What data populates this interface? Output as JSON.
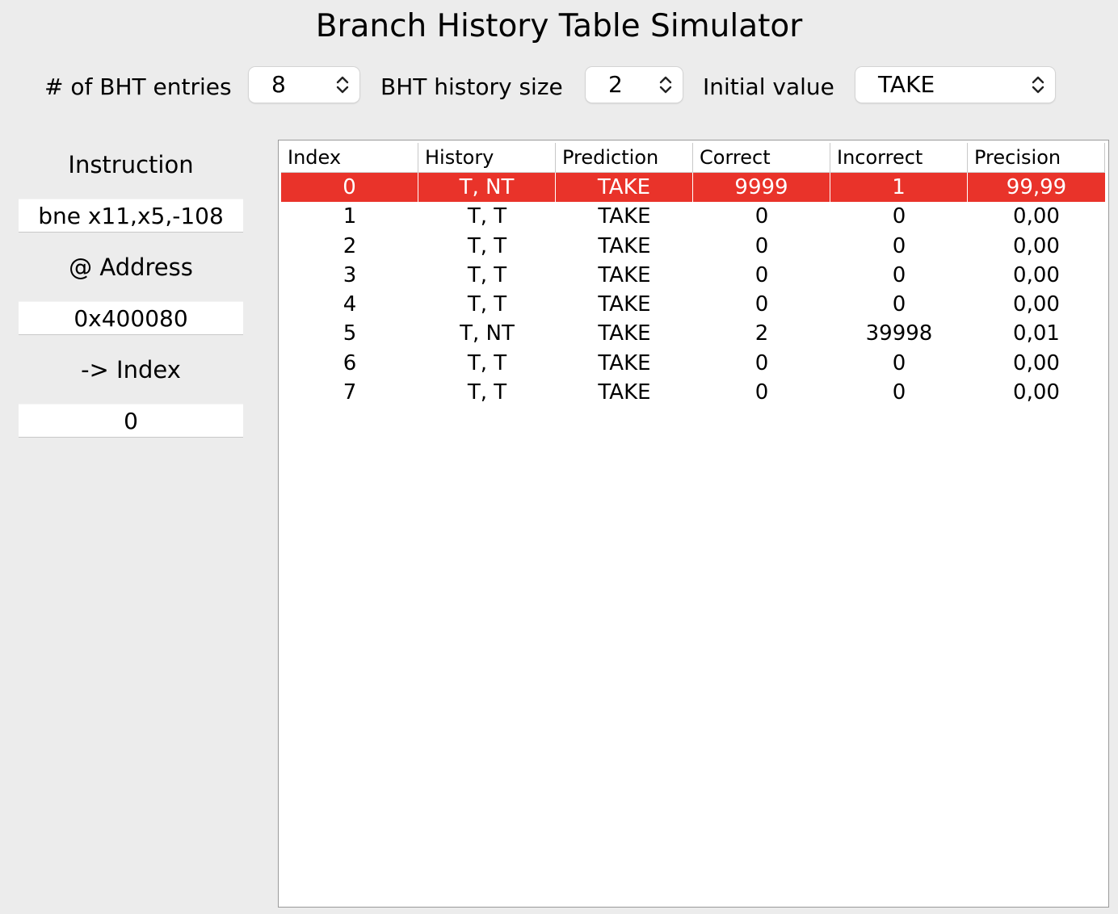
{
  "title": "Branch History Table Simulator",
  "controls": {
    "entries_label": "# of BHT entries",
    "entries_value": "8",
    "history_label": "BHT history size",
    "history_value": "2",
    "initial_label": "Initial value",
    "initial_value": "TAKE"
  },
  "sidebar": {
    "instruction_label": "Instruction",
    "instruction_value": "bne x11,x5,-108",
    "address_label": "@ Address",
    "address_value": "0x400080",
    "index_label": "-> Index",
    "index_value": "0"
  },
  "table": {
    "columns": [
      "Index",
      "History",
      "Prediction",
      "Correct",
      "Incorrect",
      "Precision"
    ],
    "selected_row": 0,
    "selected_color": "#e9332a",
    "rows": [
      [
        "0",
        "T, NT",
        "TAKE",
        "9999",
        "1",
        "99,99"
      ],
      [
        "1",
        "T, T",
        "TAKE",
        "0",
        "0",
        "0,00"
      ],
      [
        "2",
        "T, T",
        "TAKE",
        "0",
        "0",
        "0,00"
      ],
      [
        "3",
        "T, T",
        "TAKE",
        "0",
        "0",
        "0,00"
      ],
      [
        "4",
        "T, T",
        "TAKE",
        "0",
        "0",
        "0,00"
      ],
      [
        "5",
        "T, NT",
        "TAKE",
        "2",
        "39998",
        "0,01"
      ],
      [
        "6",
        "T, T",
        "TAKE",
        "0",
        "0",
        "0,00"
      ],
      [
        "7",
        "T, T",
        "TAKE",
        "0",
        "0",
        "0,00"
      ]
    ]
  }
}
